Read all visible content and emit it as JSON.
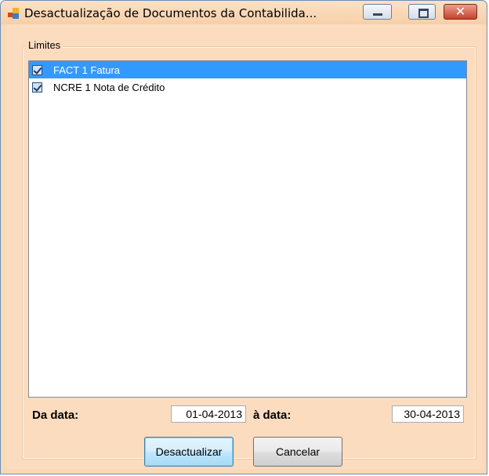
{
  "window": {
    "title": "Desactualização de Documentos da Contabilida..."
  },
  "group": {
    "label": "Limites"
  },
  "list": {
    "items": [
      {
        "label": "FACT 1 Fatura",
        "checked": true,
        "selected": true
      },
      {
        "label": "NCRE 1 Nota de Crédito",
        "checked": true,
        "selected": false
      }
    ]
  },
  "dates": {
    "from_label": "Da data:",
    "from_value": "01-04-2013",
    "to_label": "à data:",
    "to_value": "30-04-2013"
  },
  "buttons": {
    "update": "Desactualizar",
    "cancel": "Cancelar"
  },
  "colors": {
    "selection": "#3399ff",
    "client_bg": "#fbdcbf"
  }
}
